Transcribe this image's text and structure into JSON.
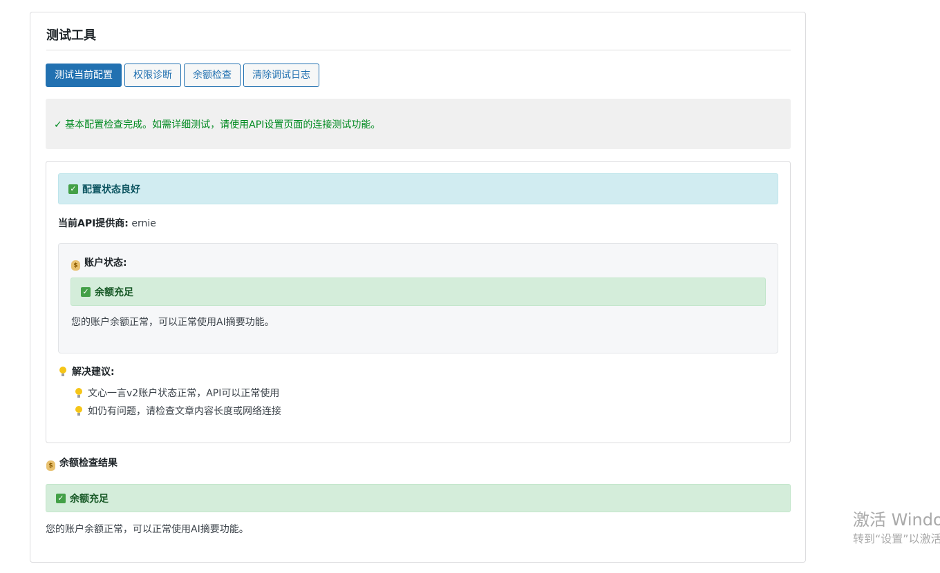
{
  "panel": {
    "title": "测试工具"
  },
  "toolbar": {
    "test_config": "测试当前配置",
    "permission_diag": "权限诊断",
    "balance_check": "余额检查",
    "clear_log": "清除调试日志"
  },
  "notice": {
    "text": "✓ 基本配置检查完成。如需详细测试，请使用API设置页面的连接测试功能。"
  },
  "result": {
    "status_alert": "配置状态良好",
    "provider_label": "当前API提供商:",
    "provider_value": " ernie",
    "account": {
      "heading": "账户状态:",
      "alert": "余额充足",
      "message": "您的账户余额正常，可以正常使用AI摘要功能。"
    },
    "suggestions": {
      "heading": "解决建议:",
      "items": [
        "文心一言v2账户状态正常，API可以正常使用",
        "如仍有问题，请检查文章内容长度或网络连接"
      ]
    }
  },
  "balance_result": {
    "heading": "余额检查结果",
    "alert": "余额充足",
    "message": "您的账户余额正常，可以正常使用AI摘要功能。"
  },
  "watermark": {
    "line1": "激活 Windo",
    "line2": "转到“设置”以激活"
  },
  "colors": {
    "primary": "#2271b1",
    "success_text": "#008a20",
    "info_bg": "#d1ecf1",
    "success_bg": "#d4edda"
  }
}
